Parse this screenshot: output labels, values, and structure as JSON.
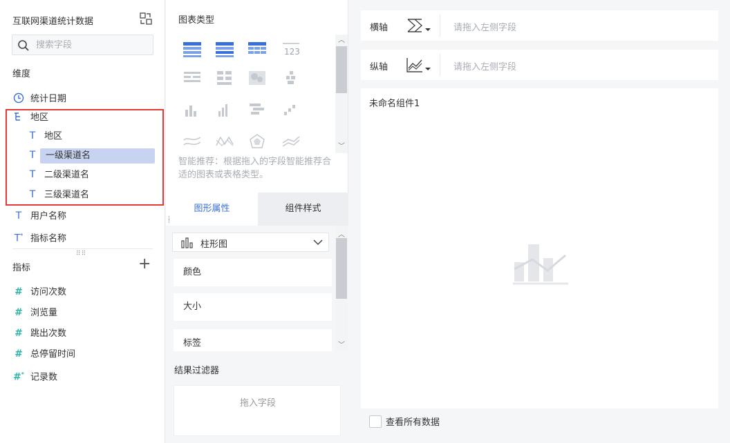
{
  "left": {
    "dataset_title": "互联网渠道统计数据",
    "search_placeholder": "搜索字段",
    "dimension_label": "维度",
    "dimensions": [
      {
        "label": "统计日期"
      },
      {
        "label": "地区"
      },
      {
        "label": "地区"
      },
      {
        "label": "一级渠道名"
      },
      {
        "label": "二级渠道名"
      },
      {
        "label": "三级渠道名"
      },
      {
        "label": "用户名称"
      },
      {
        "label": "指标名称"
      }
    ],
    "measure_label": "指标",
    "measures": [
      {
        "label": "访问次数"
      },
      {
        "label": "浏览量"
      },
      {
        "label": "跳出次数"
      },
      {
        "label": "总停留时间"
      },
      {
        "label": "记录数"
      }
    ],
    "selected_field": "一级渠道名",
    "highlight_color": "#e53935"
  },
  "middle": {
    "chart_type_title": "图表类型",
    "smart_recommend_text": "智能推荐：根据拖入的字段智能推荐合适的图表或表格类型。",
    "tabs": [
      {
        "label": "图形属性",
        "active": true
      },
      {
        "label": "组件样式",
        "active": false
      }
    ],
    "chart_type_selected": "柱形图",
    "property_rows": [
      {
        "label": "颜色"
      },
      {
        "label": "大小"
      },
      {
        "label": "标签"
      }
    ],
    "result_filter_title": "结果过滤器",
    "filter_drop_placeholder": "拖入字段",
    "accent_color": "#3a6fd8"
  },
  "right": {
    "x_axis_label": "横轴",
    "y_axis_label": "纵轴",
    "x_axis_placeholder": "请拖入左侧字段",
    "y_axis_placeholder": "请拖入左侧字段",
    "component_title": "未命名组件1",
    "view_all_data_label": "查看所有数据"
  }
}
